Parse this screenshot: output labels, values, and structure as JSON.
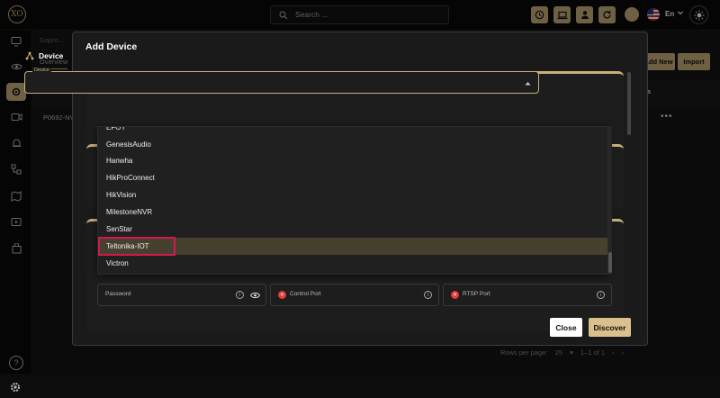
{
  "app": {
    "logo_text": "XO"
  },
  "search": {
    "placeholder": "Search ..."
  },
  "header": {
    "language": "En"
  },
  "background": {
    "breadcrumb": "Gapro...",
    "tab_overview": "Overview",
    "add_new_label": "Add New",
    "import_label": "Import",
    "col_device": "Device",
    "col_s": "s",
    "row_device": "P0692-NV",
    "more": "•••",
    "rows_per_page_label": "Rows per page:",
    "rows_per_page_value": "25",
    "range": "1–1 of 1"
  },
  "modal": {
    "title": "Add Device",
    "section_device": "Device",
    "device_field_label": "Device",
    "options": [
      {
        "label": "EFOY",
        "highlighted": false
      },
      {
        "label": "GenesisAudio",
        "highlighted": false
      },
      {
        "label": "Hanwha",
        "highlighted": false
      },
      {
        "label": "HikProConnect",
        "highlighted": false
      },
      {
        "label": "HikVision",
        "highlighted": false
      },
      {
        "label": "MilestoneNVR",
        "highlighted": false
      },
      {
        "label": "SenStar",
        "highlighted": false
      },
      {
        "label": "Teltonika-IOT",
        "highlighted": true
      },
      {
        "label": "Victron",
        "highlighted": false
      }
    ],
    "password_label": "Password",
    "control_port_label": "Control Port",
    "rtsp_port_label": "RTSP Port",
    "close_label": "Close",
    "discover_label": "Discover"
  },
  "colors": {
    "accent": "#c9b079",
    "highlight": "#48402f",
    "annotation": "#d4174f",
    "error": "#e53935"
  }
}
